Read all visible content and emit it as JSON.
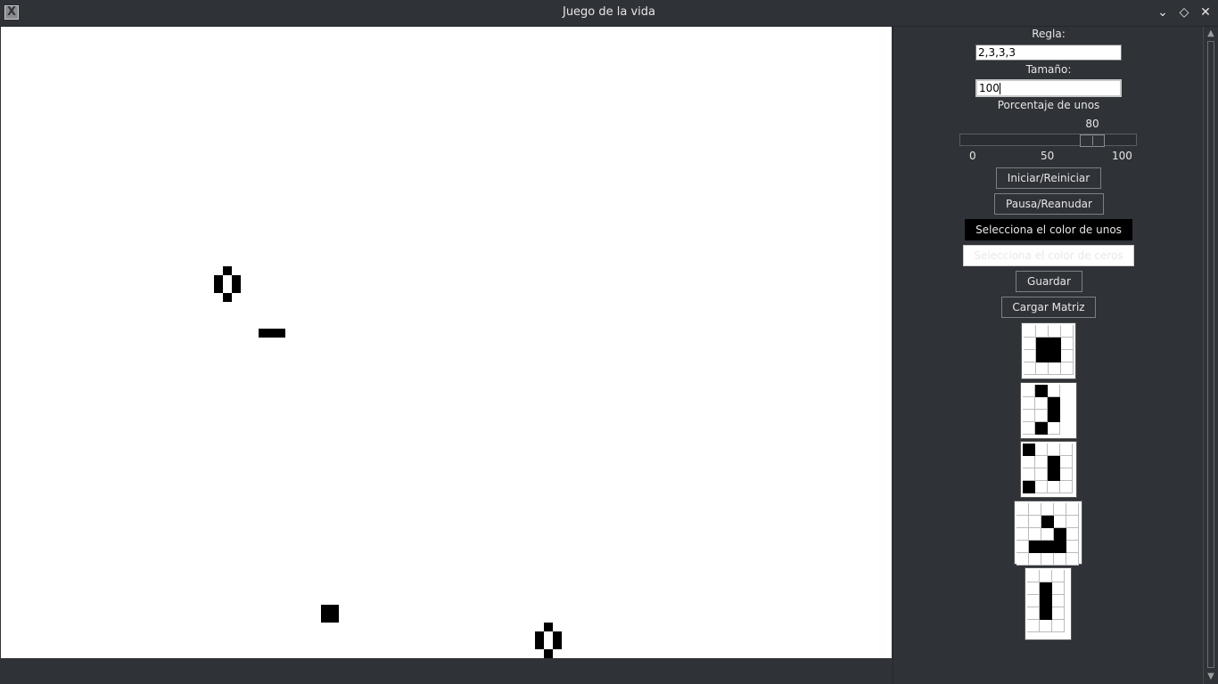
{
  "window": {
    "title": "Juego de la vida",
    "icon": "x11-app-icon",
    "controls": [
      "minimize-chevron-icon",
      "maximize-diamond-icon",
      "close-x-icon"
    ]
  },
  "grid": {
    "background": "#ffffff",
    "alive_color": "#000000",
    "alive_cells_note": ""
  },
  "panel": {
    "rule_label": "Regla:",
    "rule_value": "2,3,3,3",
    "size_label": "Tamaño:",
    "size_value": "100",
    "percent_label": "Porcentaje de unos",
    "slider": {
      "value": "80",
      "min": "0",
      "mid": "50",
      "max": "100"
    },
    "buttons": {
      "start": "Iniciar/Reiniciar",
      "pause": "Pausa/Reanudar",
      "ones_color": "Selecciona el color de unos",
      "zeros_color": "Selecciona el color de ceros",
      "save": "Guardar",
      "load": "Cargar Matriz"
    },
    "patterns": [
      {
        "name": "block",
        "cols": 4,
        "rows": 4,
        "on": [
          [
            1,
            1
          ],
          [
            1,
            2
          ],
          [
            2,
            1
          ],
          [
            2,
            2
          ]
        ]
      },
      {
        "name": "pattern-2",
        "cols": 3,
        "rows": 4,
        "on": [
          [
            0,
            1
          ],
          [
            1,
            2
          ],
          [
            2,
            2
          ],
          [
            3,
            1
          ]
        ]
      },
      {
        "name": "pattern-3",
        "cols": 4,
        "rows": 4,
        "on": [
          [
            0,
            0
          ],
          [
            1,
            2
          ],
          [
            2,
            2
          ],
          [
            3,
            0
          ]
        ]
      },
      {
        "name": "glider",
        "cols": 5,
        "rows": 5,
        "on": [
          [
            1,
            2
          ],
          [
            2,
            3
          ],
          [
            3,
            1
          ],
          [
            3,
            2
          ],
          [
            3,
            3
          ]
        ]
      },
      {
        "name": "blinker",
        "cols": 3,
        "rows": 5,
        "on": [
          [
            1,
            1
          ],
          [
            2,
            1
          ],
          [
            3,
            1
          ]
        ]
      }
    ]
  }
}
